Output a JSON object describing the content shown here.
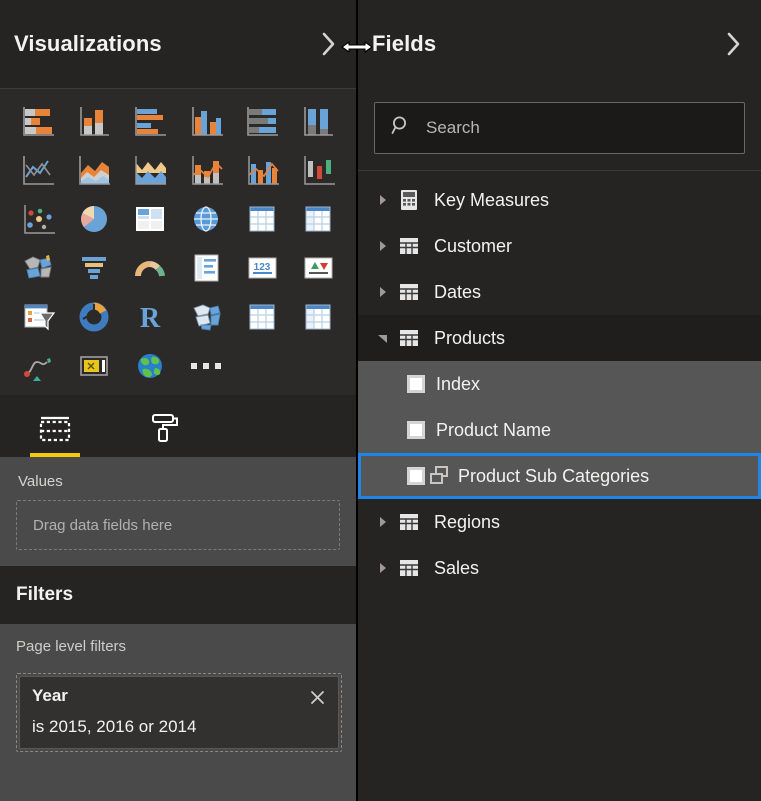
{
  "visualizations": {
    "title": "Visualizations",
    "collapse_icon": "chevron-right-icon",
    "gallery": [
      {
        "name": "stacked-bar-chart",
        "label": "Stacked bar chart"
      },
      {
        "name": "stacked-column-chart",
        "label": "Stacked column chart"
      },
      {
        "name": "clustered-bar-chart",
        "label": "Clustered bar chart"
      },
      {
        "name": "clustered-column-chart",
        "label": "Clustered column chart"
      },
      {
        "name": "hundred-percent-stacked-bar-chart",
        "label": "100% Stacked bar chart"
      },
      {
        "name": "hundred-percent-stacked-column-chart",
        "label": "100% Stacked column chart"
      },
      {
        "name": "line-chart",
        "label": "Line chart"
      },
      {
        "name": "area-chart",
        "label": "Area chart"
      },
      {
        "name": "stacked-area-chart",
        "label": "Stacked area chart"
      },
      {
        "name": "line-and-stacked-column-chart",
        "label": "Line and stacked column chart"
      },
      {
        "name": "line-and-clustered-column-chart",
        "label": "Line and clustered column chart"
      },
      {
        "name": "ribbon-chart",
        "label": "Ribbon chart"
      },
      {
        "name": "scatter-chart",
        "label": "Scatter chart"
      },
      {
        "name": "pie-chart",
        "label": "Pie chart"
      },
      {
        "name": "treemap",
        "label": "Treemap"
      },
      {
        "name": "map",
        "label": "Map"
      },
      {
        "name": "table",
        "label": "Table"
      },
      {
        "name": "matrix",
        "label": "Matrix"
      },
      {
        "name": "filled-map",
        "label": "Filled map"
      },
      {
        "name": "funnel-chart",
        "label": "Funnel"
      },
      {
        "name": "gauge-chart",
        "label": "Gauge"
      },
      {
        "name": "multi-row-card",
        "label": "Multi-row card"
      },
      {
        "name": "card",
        "label": "Card"
      },
      {
        "name": "kpi",
        "label": "KPI"
      },
      {
        "name": "slicer",
        "label": "Slicer"
      },
      {
        "name": "donut-chart",
        "label": "Donut chart"
      },
      {
        "name": "r-script-visual",
        "label": "R script visual"
      },
      {
        "name": "shape-map",
        "label": "Shape map"
      },
      {
        "name": "table-alt",
        "label": "Table"
      },
      {
        "name": "matrix-alt",
        "label": "Matrix"
      },
      {
        "name": "key-influencers",
        "label": "Key influencers"
      },
      {
        "name": "power-apps-visual",
        "label": "Power Apps visual"
      },
      {
        "name": "globe-map-visual",
        "label": "Globe map visual"
      },
      {
        "name": "more-visuals",
        "label": "More visuals"
      }
    ],
    "tabs": [
      {
        "name": "fields-tab",
        "icon": "fields-table-icon",
        "active": true
      },
      {
        "name": "format-tab",
        "icon": "paint-roller-icon",
        "active": false
      }
    ],
    "bucket": {
      "label": "Values",
      "placeholder": "Drag data fields here"
    }
  },
  "filters": {
    "title": "Filters",
    "subtitle": "Page level filters",
    "cards": [
      {
        "name": "Year",
        "condition": "is 2015, 2016 or 2014",
        "remove_icon": "close-icon"
      }
    ]
  },
  "fields": {
    "title": "Fields",
    "collapse_icon": "chevron-right-icon",
    "search": {
      "placeholder": "Search",
      "value": "",
      "icon": "search-icon"
    },
    "tree": [
      {
        "label": "Key Measures",
        "icon": "calculator-icon",
        "level": 0,
        "expanded": false,
        "state": "normal"
      },
      {
        "label": "Customer",
        "icon": "table-icon",
        "level": 0,
        "expanded": false,
        "state": "normal"
      },
      {
        "label": "Dates",
        "icon": "table-icon",
        "level": 0,
        "expanded": false,
        "state": "normal"
      },
      {
        "label": "Products",
        "icon": "table-icon",
        "level": 0,
        "expanded": true,
        "state": "expanded"
      },
      {
        "label": "Index",
        "icon": "checkbox-icon",
        "level": 1,
        "expanded": false,
        "state": "highlight"
      },
      {
        "label": "Product Name",
        "icon": "checkbox-icon",
        "level": 1,
        "expanded": false,
        "state": "highlight"
      },
      {
        "label": "Product Sub Categories",
        "icon": "checkbox-hierarchy-icon",
        "level": 1,
        "expanded": false,
        "state": "selected"
      },
      {
        "label": "Regions",
        "icon": "table-icon",
        "level": 0,
        "expanded": false,
        "state": "normal"
      },
      {
        "label": "Sales",
        "icon": "table-icon",
        "level": 0,
        "expanded": false,
        "state": "normal"
      }
    ]
  },
  "cursor": {
    "name": "horizontal-resize-cursor"
  },
  "colors": {
    "pane_bg": "#252423",
    "bucket_bg": "#4a4a4a",
    "row_highlight": "#565656",
    "selection_blue": "#1f86e8",
    "accent_yellow": "#f2c811",
    "icon_orange": "#e8833a",
    "icon_blue": "#6aa3d8",
    "icon_gray": "#c8c8c8"
  }
}
